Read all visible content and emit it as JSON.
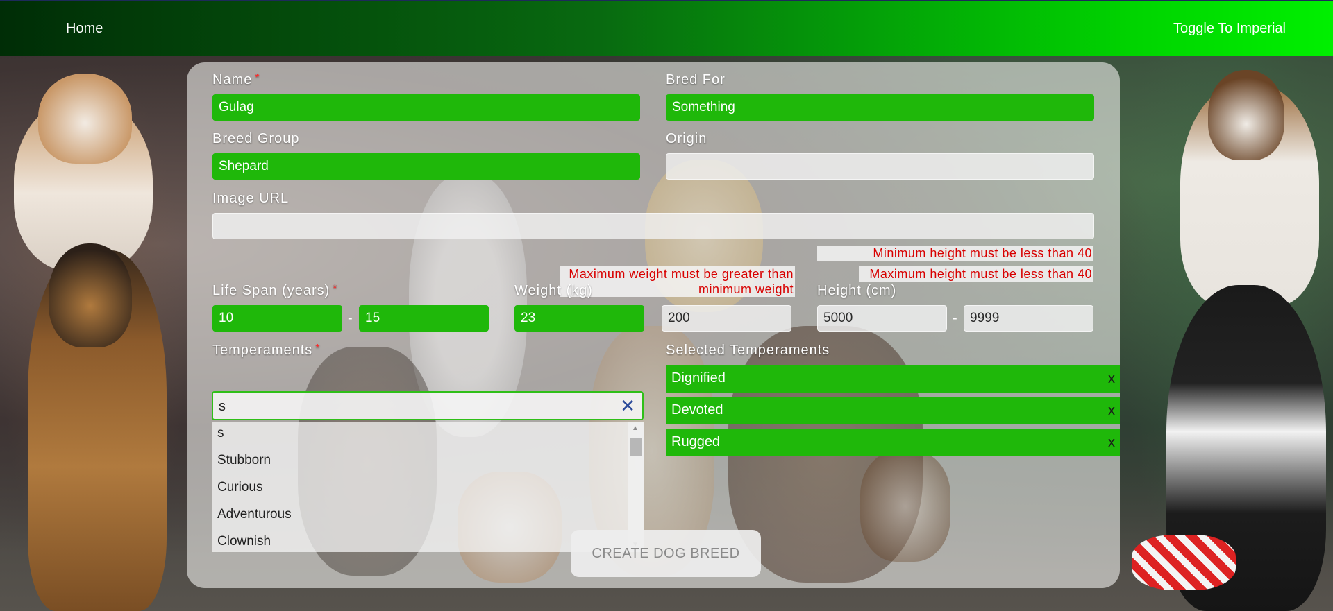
{
  "nav": {
    "home_label": "Home",
    "toggle_label": "Toggle To Imperial"
  },
  "form": {
    "name": {
      "label": "Name",
      "required_mark": "*",
      "value": "Gulag"
    },
    "bred_for": {
      "label": "Bred For",
      "value": "Something"
    },
    "breed_group": {
      "label": "Breed Group",
      "value": "Shepard"
    },
    "origin": {
      "label": "Origin",
      "value": ""
    },
    "image_url": {
      "label": "Image URL",
      "value": ""
    },
    "life_span": {
      "label": "Life Span (years)",
      "required_mark": "*",
      "min": "10",
      "max": "15"
    },
    "weight": {
      "label": "Weight (kg)",
      "min": "23",
      "max": "200",
      "error": "Maximum weight must be greater than minimum weight"
    },
    "height": {
      "label": "Height (cm)",
      "min": "5000",
      "max": "9999",
      "error_min": "Minimum height must be less than 40",
      "error_max": "Maximum height must be less than 40"
    },
    "separator": "-",
    "temperaments": {
      "label": "Temperaments",
      "required_mark": "*",
      "search_value": "s",
      "clear_icon": "close-icon",
      "options": [
        "s",
        "Stubborn",
        "Curious",
        "Adventurous",
        "Clownish"
      ]
    },
    "selected_temperaments": {
      "label": "Selected Temperaments",
      "remove_label": "x",
      "items": [
        "Dignified",
        "Devoted",
        "Rugged"
      ]
    },
    "submit_label": "CREATE DOG BREED"
  },
  "colors": {
    "valid_green": "#1fb80a",
    "error_red": "#d80000",
    "nav_gradient_start": "#002d06",
    "nav_gradient_end": "#00f000"
  }
}
